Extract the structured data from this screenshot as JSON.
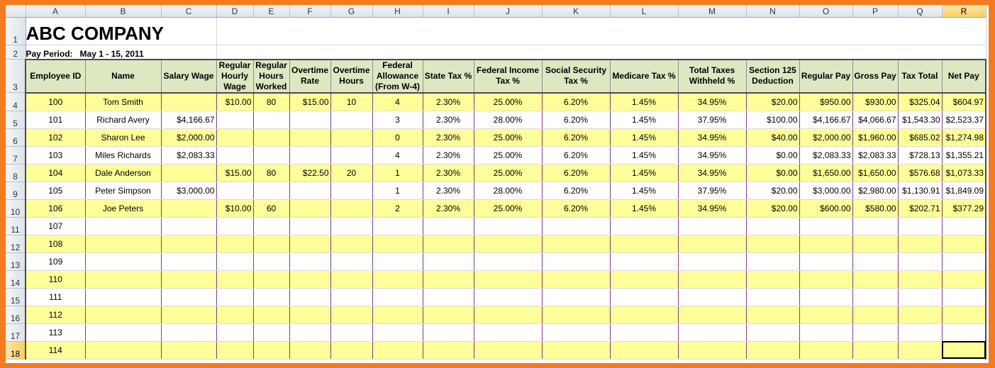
{
  "sheet": {
    "columns": [
      "A",
      "B",
      "C",
      "D",
      "E",
      "F",
      "G",
      "H",
      "I",
      "J",
      "K",
      "L",
      "M",
      "N",
      "O",
      "P",
      "Q",
      "R"
    ],
    "selected_column": "R",
    "selected_row": "18",
    "title": "ABC COMPANY",
    "pay_period_label": "Pay Period:",
    "pay_period_value": "May 1 - 15, 2011",
    "headers": [
      "Employee ID",
      "Name",
      "Salary Wage",
      "Regular Hourly Wage",
      "Regular Hours Worked",
      "Overtime Rate",
      "Overtime Hours",
      "Federal Allowance (From W-4)",
      "State Tax %",
      "Federal Income Tax %",
      "Social Security Tax %",
      "Medicare Tax %",
      "Total Taxes Withheld %",
      "Section 125 Deduction",
      "Regular Pay",
      "Gross Pay",
      "Tax Total",
      "Net Pay"
    ],
    "rows": [
      {
        "row": "4",
        "cells": [
          "100",
          "Tom Smith",
          "",
          "$10.00",
          "80",
          "$15.00",
          "10",
          "4",
          "2.30%",
          "25.00%",
          "6.20%",
          "1.45%",
          "34.95%",
          "$20.00",
          "$950.00",
          "$930.00",
          "$325.04",
          "$604.97"
        ]
      },
      {
        "row": "5",
        "cells": [
          "101",
          "Richard Avery",
          "$4,166.67",
          "",
          "",
          "",
          "",
          "3",
          "2.30%",
          "28.00%",
          "6.20%",
          "1.45%",
          "37.95%",
          "$100.00",
          "$4,166.67",
          "$4,066.67",
          "$1,543.30",
          "$2,523.37"
        ]
      },
      {
        "row": "6",
        "cells": [
          "102",
          "Sharon Lee",
          "$2,000.00",
          "",
          "",
          "",
          "",
          "0",
          "2.30%",
          "25.00%",
          "6.20%",
          "1.45%",
          "34.95%",
          "$40.00",
          "$2,000.00",
          "$1,960.00",
          "$685.02",
          "$1,274.98"
        ]
      },
      {
        "row": "7",
        "cells": [
          "103",
          "Miles Richards",
          "$2,083.33",
          "",
          "",
          "",
          "",
          "4",
          "2.30%",
          "25.00%",
          "6.20%",
          "1.45%",
          "34.95%",
          "$0.00",
          "$2,083.33",
          "$2,083.33",
          "$728.13",
          "$1,355.21"
        ]
      },
      {
        "row": "8",
        "cells": [
          "104",
          "Dale Anderson",
          "",
          "$15.00",
          "80",
          "$22.50",
          "20",
          "1",
          "2.30%",
          "25.00%",
          "6.20%",
          "1.45%",
          "34.95%",
          "$0.00",
          "$1,650.00",
          "$1,650.00",
          "$576.68",
          "$1,073.33"
        ]
      },
      {
        "row": "9",
        "cells": [
          "105",
          "Peter Simpson",
          "$3,000.00",
          "",
          "",
          "",
          "",
          "1",
          "2.30%",
          "28.00%",
          "6.20%",
          "1.45%",
          "37.95%",
          "$20.00",
          "$3,000.00",
          "$2,980.00",
          "$1,130.91",
          "$1,849.09"
        ]
      },
      {
        "row": "10",
        "cells": [
          "106",
          "Joe Peters",
          "",
          "$10.00",
          "60",
          "",
          "",
          "2",
          "2.30%",
          "25.00%",
          "6.20%",
          "1.45%",
          "34.95%",
          "$20.00",
          "$600.00",
          "$580.00",
          "$202.71",
          "$377.29"
        ]
      },
      {
        "row": "11",
        "cells": [
          "107",
          "",
          "",
          "",
          "",
          "",
          "",
          "",
          "",
          "",
          "",
          "",
          "",
          "",
          "",
          "",
          "",
          ""
        ]
      },
      {
        "row": "12",
        "cells": [
          "108",
          "",
          "",
          "",
          "",
          "",
          "",
          "",
          "",
          "",
          "",
          "",
          "",
          "",
          "",
          "",
          "",
          ""
        ]
      },
      {
        "row": "13",
        "cells": [
          "109",
          "",
          "",
          "",
          "",
          "",
          "",
          "",
          "",
          "",
          "",
          "",
          "",
          "",
          "",
          "",
          "",
          ""
        ]
      },
      {
        "row": "14",
        "cells": [
          "110",
          "",
          "",
          "",
          "",
          "",
          "",
          "",
          "",
          "",
          "",
          "",
          "",
          "",
          "",
          "",
          "",
          ""
        ]
      },
      {
        "row": "15",
        "cells": [
          "111",
          "",
          "",
          "",
          "",
          "",
          "",
          "",
          "",
          "",
          "",
          "",
          "",
          "",
          "",
          "",
          "",
          ""
        ]
      },
      {
        "row": "16",
        "cells": [
          "112",
          "",
          "",
          "",
          "",
          "",
          "",
          "",
          "",
          "",
          "",
          "",
          "",
          "",
          "",
          "",
          "",
          ""
        ]
      },
      {
        "row": "17",
        "cells": [
          "113",
          "",
          "",
          "",
          "",
          "",
          "",
          "",
          "",
          "",
          "",
          "",
          "",
          "",
          "",
          "",
          "",
          ""
        ]
      },
      {
        "row": "18",
        "cells": [
          "114",
          "",
          "",
          "",
          "",
          "",
          "",
          "",
          "",
          "",
          "",
          "",
          "",
          "",
          "",
          "",
          "",
          ""
        ]
      }
    ],
    "colors": {
      "frame": "#f47b20",
      "header_fill": "#dde8c3",
      "stripe_fill": "#ffff99",
      "column_rule": "#7e3f7e"
    }
  }
}
